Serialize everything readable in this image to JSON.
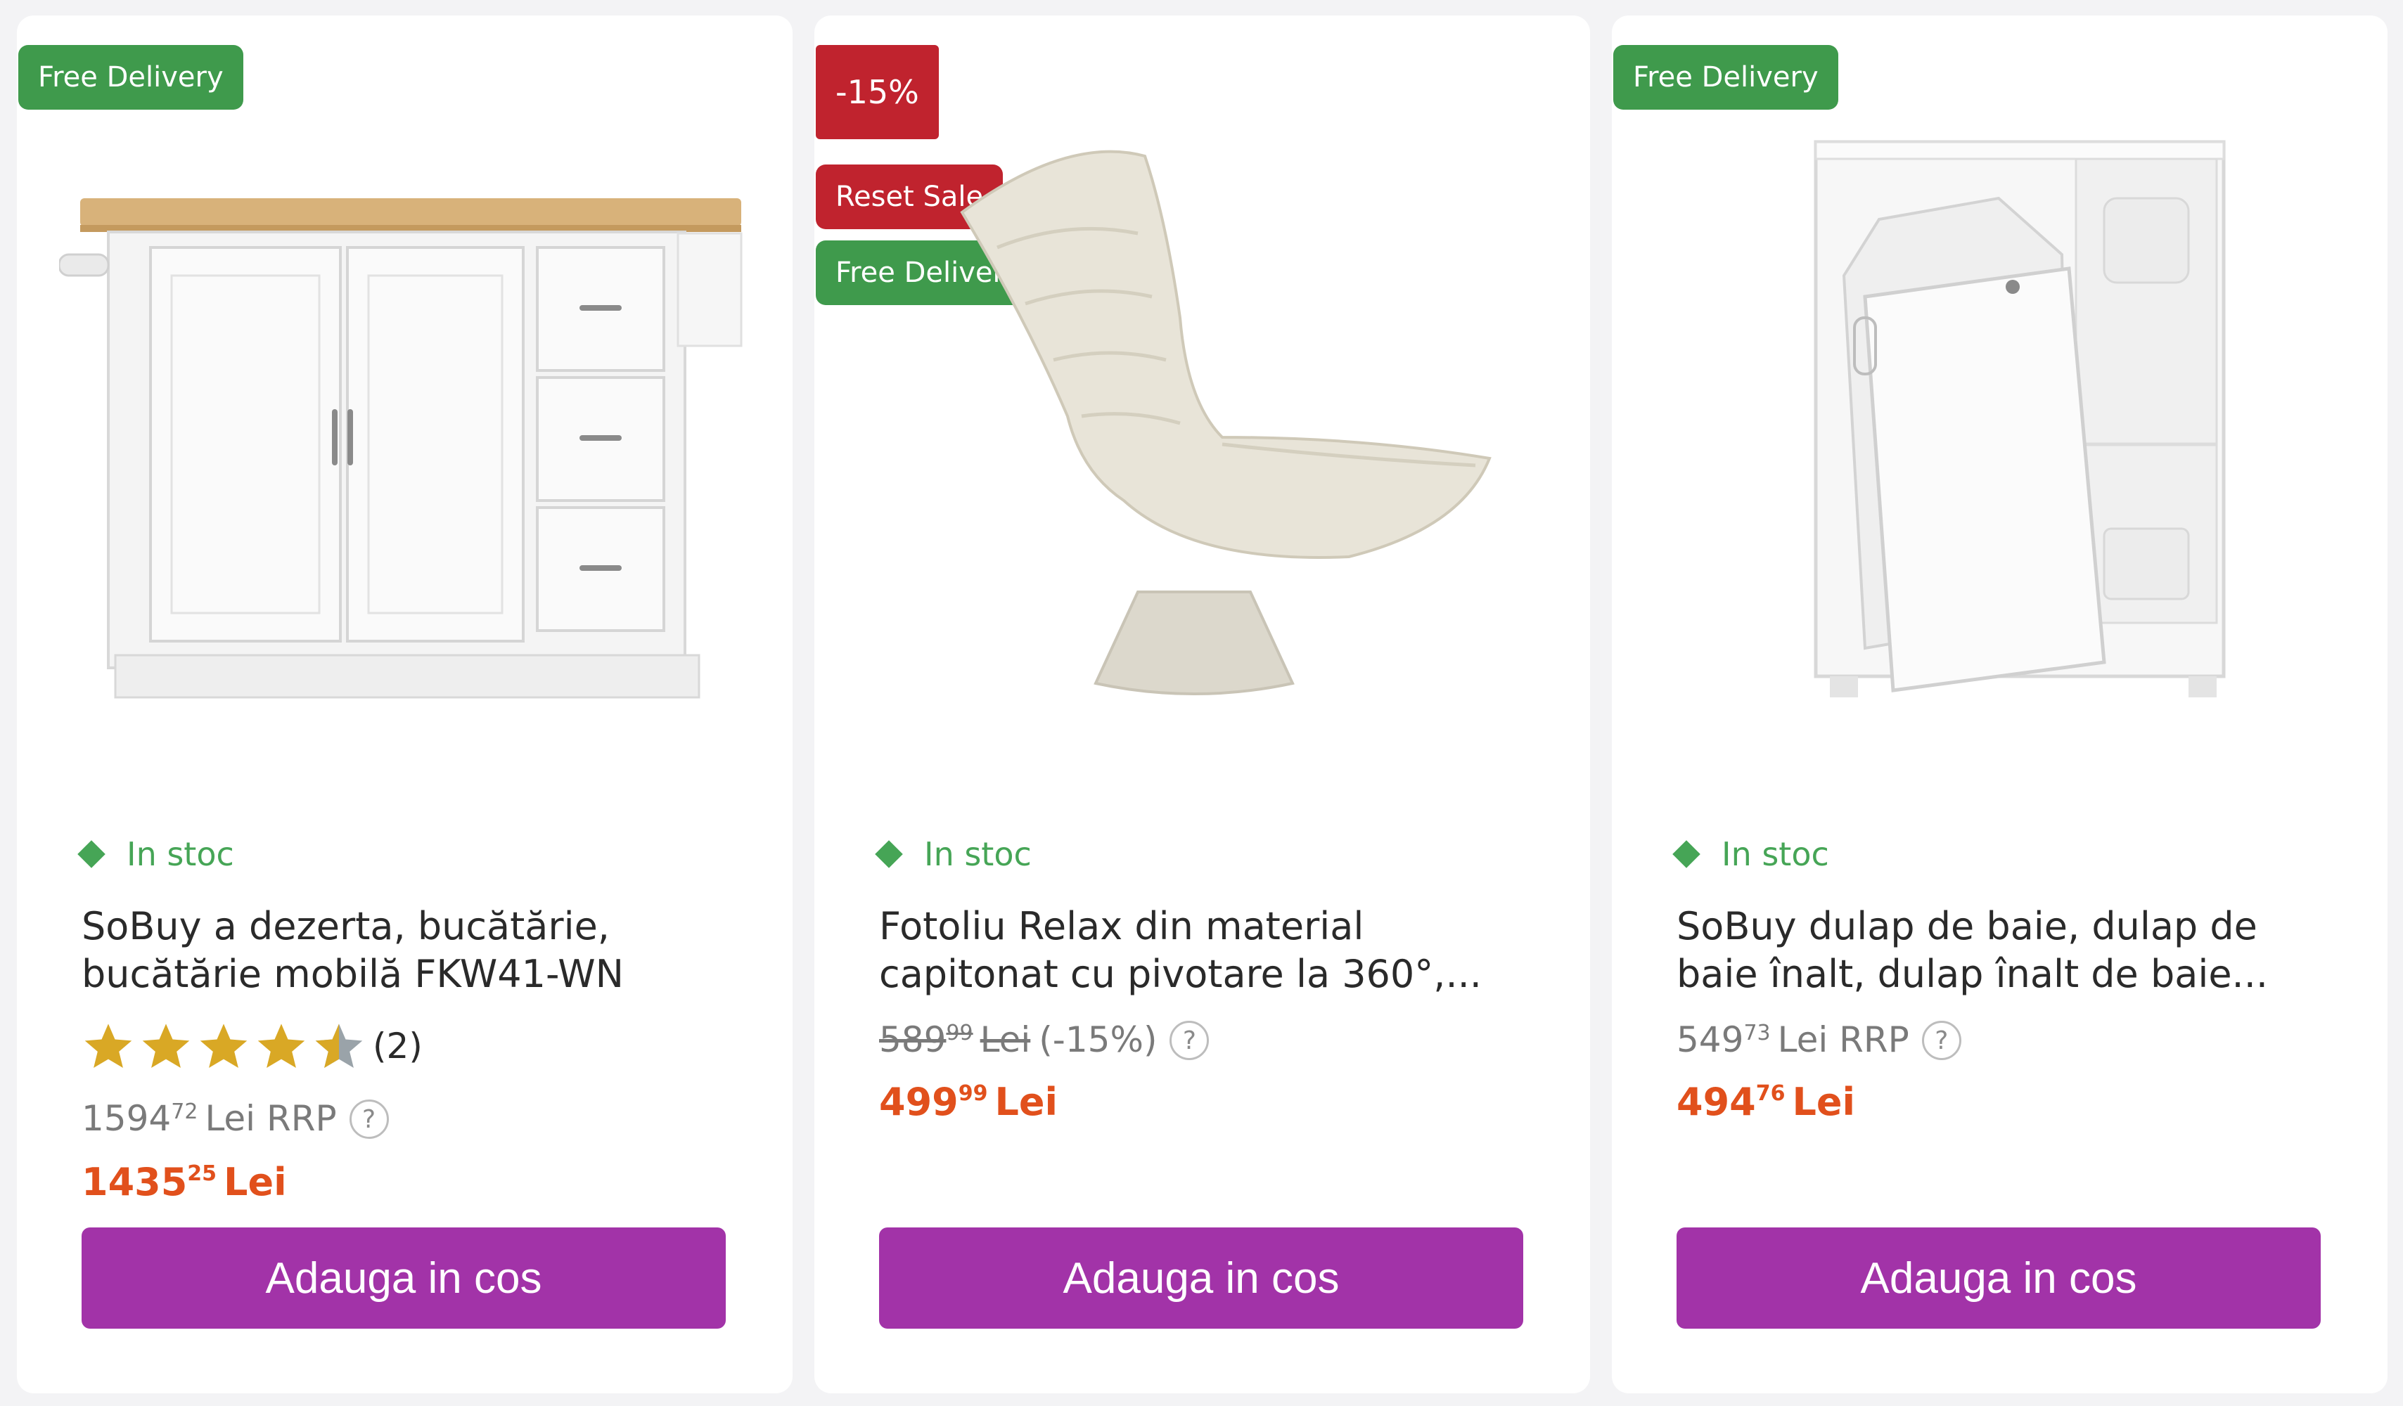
{
  "colors": {
    "accent_button": "#a233a8",
    "price": "#e1501c",
    "in_stock": "#46a556",
    "badge_green": "#3f9a4c",
    "badge_red": "#c0232e",
    "star_gold": "#d9a825"
  },
  "products": [
    {
      "badges": [
        "Free Delivery"
      ],
      "stock": "In stoc",
      "title_line1": "SoBuy a dezerta, bucătărie,",
      "title_line2": "bucătărie mobilă FKW41-WN",
      "rating_value": 4.5,
      "rating_count": "(2)",
      "rrp_int": "1594",
      "rrp_dec": "72",
      "rrp_suffix": "Lei RRP",
      "price_int": "1435",
      "price_dec": "25",
      "price_currency": "Lei",
      "button_label": "Adauga in cos",
      "image_icon": "kitchen-island-image"
    },
    {
      "badges": [
        "-15%",
        "Reset Sale",
        "Free Delivery"
      ],
      "stock": "In stoc",
      "title_line1": "Fotoliu Relax din material",
      "title_line2": "capitonat cu pivotare la 360°,...",
      "old_price_int": "589",
      "old_price_dec": "99",
      "old_price_currency": "Lei",
      "discount_text": "(-15%)",
      "price_int": "499",
      "price_dec": "99",
      "price_currency": "Lei",
      "button_label": "Adauga in cos",
      "image_icon": "lounge-chair-image"
    },
    {
      "badges": [
        "Free Delivery"
      ],
      "stock": "In stoc",
      "title_line1": "SoBuy dulap de baie, dulap de",
      "title_line2": "baie înalt, dulap înalt de baie...",
      "rrp_int": "549",
      "rrp_dec": "73",
      "rrp_suffix": "Lei RRP",
      "price_int": "494",
      "price_dec": "76",
      "price_currency": "Lei",
      "button_label": "Adauga in cos",
      "image_icon": "bathroom-cabinet-image"
    }
  ],
  "help_glyph": "?"
}
